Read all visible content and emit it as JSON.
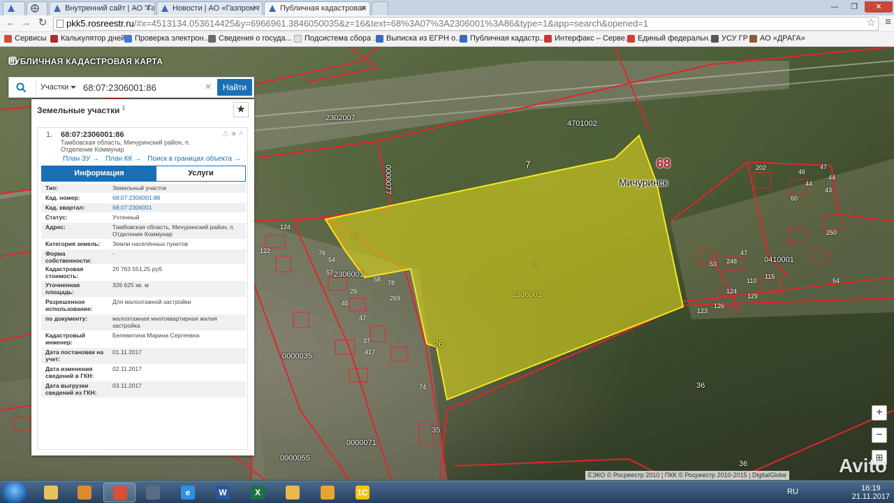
{
  "browser": {
    "tabs": [
      {
        "label": "",
        "icon": "cadastre-icon"
      },
      {
        "label": "",
        "icon": "globe-icon"
      },
      {
        "label": "Внутренний сайт | АО \"Га",
        "icon": "cadastre-icon"
      },
      {
        "label": "Новости | АО «Газпром г",
        "icon": "cadastre-icon"
      },
      {
        "label": "Публичная кадастровая",
        "icon": "cadastre-icon"
      }
    ],
    "url_domain": "pkk5.rosreestr.ru",
    "url_rest": "/#x=4513134.053614425&y=6966961.3846050035&z=16&text=68%3A07%3A2306001%3A86&type=1&app=search&opened=1",
    "bookmarks": [
      {
        "label": "Сервисы",
        "color": "#d44a3a"
      },
      {
        "label": "Калькулятор дней",
        "color": "#b22b2b"
      },
      {
        "label": "Проверка электрон...",
        "color": "#3e7bd1"
      },
      {
        "label": "Сведения о госуда...",
        "color": "#6a6a6a"
      },
      {
        "label": "Подсистема сбора ...",
        "color": "#e0e0e0"
      },
      {
        "label": "Выписка из ЕГРН о...",
        "color": "#3b6bbd"
      },
      {
        "label": "Публичная кадастр...",
        "color": "#3b6bbd"
      },
      {
        "label": "Интерфакс – Серве...",
        "color": "#c33"
      },
      {
        "label": "Единый федеральн...",
        "color": "#d73a3a"
      },
      {
        "label": "УСУ ГР",
        "color": "#555"
      },
      {
        "label": "АО «ДРАГА»",
        "color": "#8a5a3a"
      }
    ]
  },
  "app": {
    "title": "ПУБЛИЧНАЯ КАДАСТРОВАЯ КАРТА"
  },
  "search": {
    "type": "Участки",
    "query": "68:07:2306001:86",
    "button": "Найти"
  },
  "panel": {
    "heading": "Земельные участки",
    "heading_sup": "1",
    "fav_icon": "star-icon",
    "card": {
      "index": "1.",
      "cadastral_number": "68:07:2306001:86",
      "address": "Тамбовская область, Мичуринский район, п. Отделение Коммунар",
      "links": [
        "План ЗУ →",
        "План КК →",
        "Поиск в границах объекта →"
      ],
      "tabs": {
        "info": "Информация",
        "services": "Услуги"
      },
      "rows": [
        {
          "k": "Тип:",
          "v": "Земельный участок",
          "link": false,
          "h": 14
        },
        {
          "k": "Кад. номер:",
          "v": "68:07:2306001:86",
          "link": true,
          "h": 14
        },
        {
          "k": "Кад. квартал:",
          "v": "68:07:2306001",
          "link": true,
          "h": 14
        },
        {
          "k": "Статус:",
          "v": "Учтенный",
          "link": false,
          "h": 14
        },
        {
          "k": "Адрес:",
          "v": "Тамбовская область, Мичуринский район, п. Отделение Коммунар",
          "link": false,
          "h": 24
        },
        {
          "k": "Категория земель:",
          "v": "Земли населённых пунктов",
          "link": false,
          "h": 14
        },
        {
          "k": "Форма собственности:",
          "v": "-",
          "link": false,
          "h": 22
        },
        {
          "k": "Кадастровая стоимость:",
          "v": "20 763 551,25 руб.",
          "link": false,
          "h": 23
        },
        {
          "k": "Уточненная площадь:",
          "v": "326 625 кв. м",
          "link": false,
          "h": 24
        },
        {
          "k": "Разрешенное использование:",
          "v": "Для малоэтажной застройки",
          "link": false,
          "h": 24
        },
        {
          "k": "по документу:",
          "v": "малоэтажная многоквартирная жилая застройка",
          "link": false,
          "h": 24
        },
        {
          "k": "Кадастровый инженер:",
          "v": "Белевитина Марина Сергеевна",
          "link": false,
          "h": 24
        },
        {
          "k": "Дата постановки на учет:",
          "v": "01.11.2017",
          "link": false,
          "h": 24
        },
        {
          "k": "Дата изменения сведений в ГКН:",
          "v": "02.11.2017",
          "link": false,
          "h": 24
        },
        {
          "k": "Дата выгрузки сведений из ГКН:",
          "v": "03.11.2017",
          "link": false,
          "h": 24
        }
      ]
    }
  },
  "map": {
    "region_label": "68",
    "city_label": "Мичуринск",
    "labels_white": [
      "2302007",
      "4701002",
      "7",
      "0000077",
      "2306001",
      "0410001",
      "0000035",
      "0000055",
      "0000058",
      "0000071",
      "0000076",
      "36",
      "35",
      "36"
    ],
    "labels_yellow": [
      "86",
      "86",
      "2306001",
      "26"
    ],
    "small_numbers": [
      "124",
      "122",
      "76",
      "54",
      "57",
      "58",
      "78",
      "269",
      "45",
      "29",
      "47",
      "37",
      "417",
      "74",
      "202",
      "46",
      "47",
      "44",
      "43",
      "250",
      "44",
      "110",
      "115",
      "129",
      "54",
      "123",
      "126",
      "124",
      "248",
      "47",
      "53",
      "60"
    ],
    "parcel_color": "#d8d21c",
    "boundary_color": "#e2252c",
    "attribution": "ЕЭКО © Росреестр 2010 | ПКК © Росреестр 2010-2015 | DigitalGlobe",
    "watermark": "Avito",
    "zoom": {
      "in": "+",
      "out": "−",
      "extra": "⊞"
    }
  },
  "taskbar": {
    "apps": [
      {
        "name": "explorer-app",
        "label": "",
        "color": "#e8c25a"
      },
      {
        "name": "media-app",
        "label": "",
        "color": "#e08a2c"
      },
      {
        "name": "chrome-app",
        "label": "",
        "color": "#dd4b39"
      },
      {
        "name": "calculator-app",
        "label": "",
        "color": "#5a6b85"
      },
      {
        "name": "ie-app",
        "label": "e",
        "color": "#2f8fe0"
      },
      {
        "name": "word-app",
        "label": "W",
        "color": "#2b5797"
      },
      {
        "name": "excel-app",
        "label": "X",
        "color": "#1e7145"
      },
      {
        "name": "folder-app",
        "label": "",
        "color": "#e9b84a"
      },
      {
        "name": "outlook-app",
        "label": "",
        "color": "#e8a431"
      },
      {
        "name": "1c-app",
        "label": "1С",
        "color": "#f5c400"
      }
    ],
    "lang": "RU",
    "time": "16:19",
    "date": "21.11.2017"
  }
}
